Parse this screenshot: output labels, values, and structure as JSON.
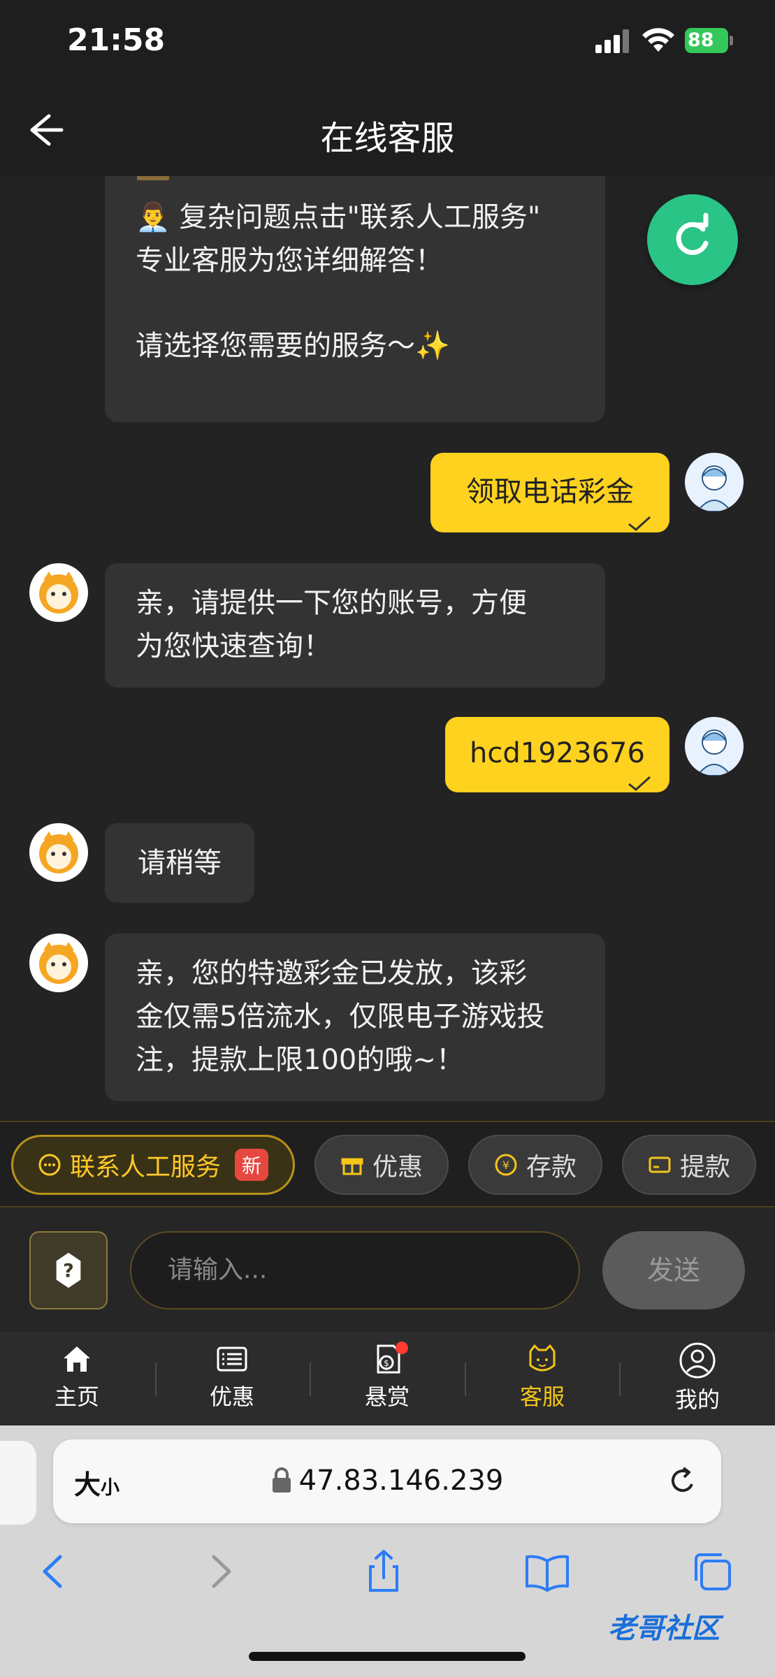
{
  "status": {
    "time": "21:58",
    "battery": "88"
  },
  "header": {
    "title": "在线客服"
  },
  "messages": {
    "intro_line1": "👨‍💼 复杂问题点击\"联系人工服务\"",
    "intro_line2": "专业客服为您详细解答！",
    "intro_line3": "请选择您需要的服务～✨",
    "out1": "领取电话彩金",
    "in1_line1": "亲，请提供一下您的账号，方便",
    "in1_line2": "为您快速查询！",
    "out2": "hcd1923676",
    "in2": "请稍等",
    "in3_line1": "亲，您的特邀彩金已发放，该彩",
    "in3_line2": "金仅需5倍流水，仅限电子游戏投",
    "in3_line3": "注，提款上限100的哦~！"
  },
  "quick_actions": {
    "human": "联系人工服务",
    "new_badge": "新",
    "promo": "优惠",
    "deposit": "存款",
    "withdraw": "提款"
  },
  "input": {
    "placeholder": "请输入...",
    "send": "发送"
  },
  "tabs": {
    "home": "主页",
    "promo": "优惠",
    "reward": "悬赏",
    "service": "客服",
    "mine": "我的"
  },
  "browser": {
    "text_size_big": "大",
    "text_size_small": "小",
    "url": "47.83.146.239",
    "watermark": "老哥社区"
  },
  "colors": {
    "accent": "#ffd21f",
    "fab": "#29c486",
    "badge": "#e5483f"
  }
}
